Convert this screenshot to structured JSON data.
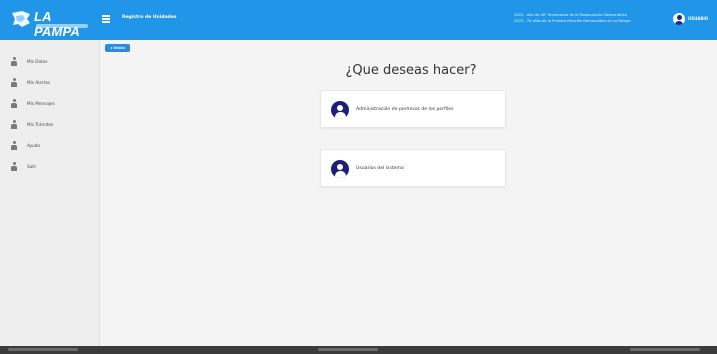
{
  "header": {
    "logo_text": "LA PAMPA",
    "breadcrumb": "Registro de Unidades",
    "announcements": [
      "2023 - Año de 40° Aniversario de la Restauración Democrática",
      "2023 - 70 años de la Primera Elección Democrática en La Pampa"
    ],
    "user_name": "USUARIO",
    "accent_color": "#2196e8"
  },
  "sidebar": {
    "items": [
      {
        "label": "Mis Datos",
        "icon": "user-icon"
      },
      {
        "label": "Mis Alertas",
        "icon": "user-icon"
      },
      {
        "label": "Mis Mensajes",
        "icon": "user-icon"
      },
      {
        "label": "Mis Trámites",
        "icon": "user-icon"
      },
      {
        "label": "Ayuda",
        "icon": "user-icon"
      },
      {
        "label": "Salir",
        "icon": "user-icon"
      }
    ]
  },
  "main": {
    "home_button": "◂ Inicio",
    "heading": "¿Que deseas hacer?",
    "cards": [
      {
        "label": "Administración de permisos de los perfiles",
        "icon": "user-circle-icon",
        "color": "#1b1f7a"
      },
      {
        "label": "Usuarios del sistema",
        "icon": "user-circle-icon",
        "color": "#1b1f7a"
      }
    ]
  }
}
